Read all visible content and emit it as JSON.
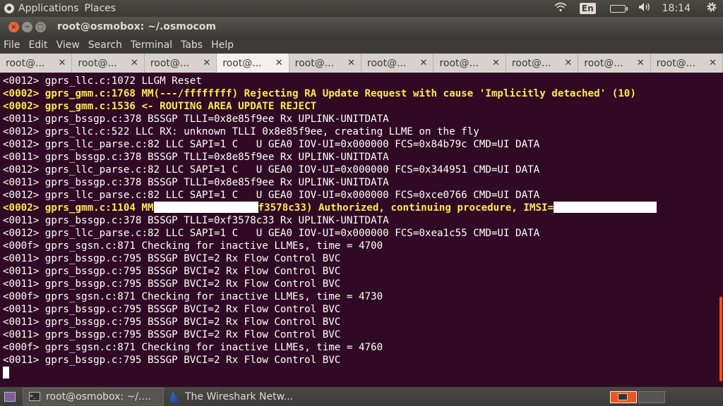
{
  "top_panel": {
    "menus": [
      "Applications",
      "Places"
    ],
    "keyboard_layout": "En",
    "clock": "18:14"
  },
  "window": {
    "title": "root@osmobox: ~/.osmocom"
  },
  "menu_bar": [
    "File",
    "Edit",
    "View",
    "Search",
    "Terminal",
    "Tabs",
    "Help"
  ],
  "tabs": [
    {
      "label": "root@...",
      "active": false
    },
    {
      "label": "root@...",
      "active": false
    },
    {
      "label": "root@...",
      "active": false
    },
    {
      "label": "root@...",
      "active": true
    },
    {
      "label": "root@...",
      "active": false
    },
    {
      "label": "root@...",
      "active": false
    },
    {
      "label": "root@...",
      "active": false
    },
    {
      "label": "root@...",
      "active": false
    },
    {
      "label": "root@...",
      "active": false
    },
    {
      "label": "root@...",
      "active": false
    }
  ],
  "terminal": {
    "lines": [
      {
        "text": "<0012> gprs_llc.c:1072 LLGM Reset",
        "highlight": false
      },
      {
        "text": "<0002> gprs_gmm.c:1768 MM(---/ffffffff) Rejecting RA Update Request with cause 'Implicitly detached' (10)",
        "highlight": true
      },
      {
        "text": "<0002> gprs_gmm.c:1536 <- ROUTING AREA UPDATE REJECT",
        "highlight": true
      },
      {
        "text": "<0011> gprs_bssgp.c:378 BSSGP TLLI=0x8e85f9ee Rx UPLINK-UNITDATA",
        "highlight": false
      },
      {
        "text": "<0012> gprs_llc.c:522 LLC RX: unknown TLLI 0x8e85f9ee, creating LLME on the fly",
        "highlight": false
      },
      {
        "text": "<0012> gprs_llc_parse.c:82 LLC SAPI=1 C   U GEA0 IOV-UI=0x000000 FCS=0x84b79c CMD=UI DATA",
        "highlight": false
      },
      {
        "text": "<0011> gprs_bssgp.c:378 BSSGP TLLI=0x8e85f9ee Rx UPLINK-UNITDATA",
        "highlight": false
      },
      {
        "text": "<0012> gprs_llc_parse.c:82 LLC SAPI=1 C   U GEA0 IOV-UI=0x000000 FCS=0x344951 CMD=UI DATA",
        "highlight": false
      },
      {
        "text": "<0011> gprs_bssgp.c:378 BSSGP TLLI=0x8e85f9ee Rx UPLINK-UNITDATA",
        "highlight": false
      },
      {
        "text": "<0012> gprs_llc_parse.c:82 LLC SAPI=1 C   U GEA0 IOV-UI=0x000000 FCS=0xce0766 CMD=UI DATA",
        "highlight": false
      },
      {
        "text_before": "<0002> gprs_gmm.c:1104 MM",
        "text_middle": "f3578c33) Authorized, continuing procedure, IMSI=",
        "highlight": true,
        "redacted": true
      },
      {
        "text": "<0011> gprs_bssgp.c:378 BSSGP TLLI=0xf3578c33 Rx UPLINK-UNITDATA",
        "highlight": false
      },
      {
        "text": "<0012> gprs_llc_parse.c:82 LLC SAPI=1 C   U GEA0 IOV-UI=0x000000 FCS=0xea1c55 CMD=UI DATA",
        "highlight": false
      },
      {
        "text": "<000f> gprs_sgsn.c:871 Checking for inactive LLMEs, time = 4700",
        "highlight": false
      },
      {
        "text": "<0011> gprs_bssgp.c:795 BSSGP BVCI=2 Rx Flow Control BVC",
        "highlight": false
      },
      {
        "text": "<0011> gprs_bssgp.c:795 BSSGP BVCI=2 Rx Flow Control BVC",
        "highlight": false
      },
      {
        "text": "<0011> gprs_bssgp.c:795 BSSGP BVCI=2 Rx Flow Control BVC",
        "highlight": false
      },
      {
        "text": "<000f> gprs_sgsn.c:871 Checking for inactive LLMEs, time = 4730",
        "highlight": false
      },
      {
        "text": "<0011> gprs_bssgp.c:795 BSSGP BVCI=2 Rx Flow Control BVC",
        "highlight": false
      },
      {
        "text": "<0011> gprs_bssgp.c:795 BSSGP BVCI=2 Rx Flow Control BVC",
        "highlight": false
      },
      {
        "text": "<0011> gprs_bssgp.c:795 BSSGP BVCI=2 Rx Flow Control BVC",
        "highlight": false
      },
      {
        "text": "<000f> gprs_sgsn.c:871 Checking for inactive LLMEs, time = 4760",
        "highlight": false
      },
      {
        "text": "<0011> gprs_bssgp.c:795 BSSGP BVCI=2 Rx Flow Control BVC",
        "highlight": false
      }
    ],
    "colors": {
      "background": "#300a24",
      "text": "#ffffff",
      "highlight": "#fce94f"
    }
  },
  "taskbar": {
    "tasks": [
      {
        "label": "root@osmobox: ~/....",
        "icon": "terminal-icon",
        "active": true
      },
      {
        "label": "The Wireshark Netw...",
        "icon": "wireshark-icon",
        "active": false
      }
    ]
  }
}
